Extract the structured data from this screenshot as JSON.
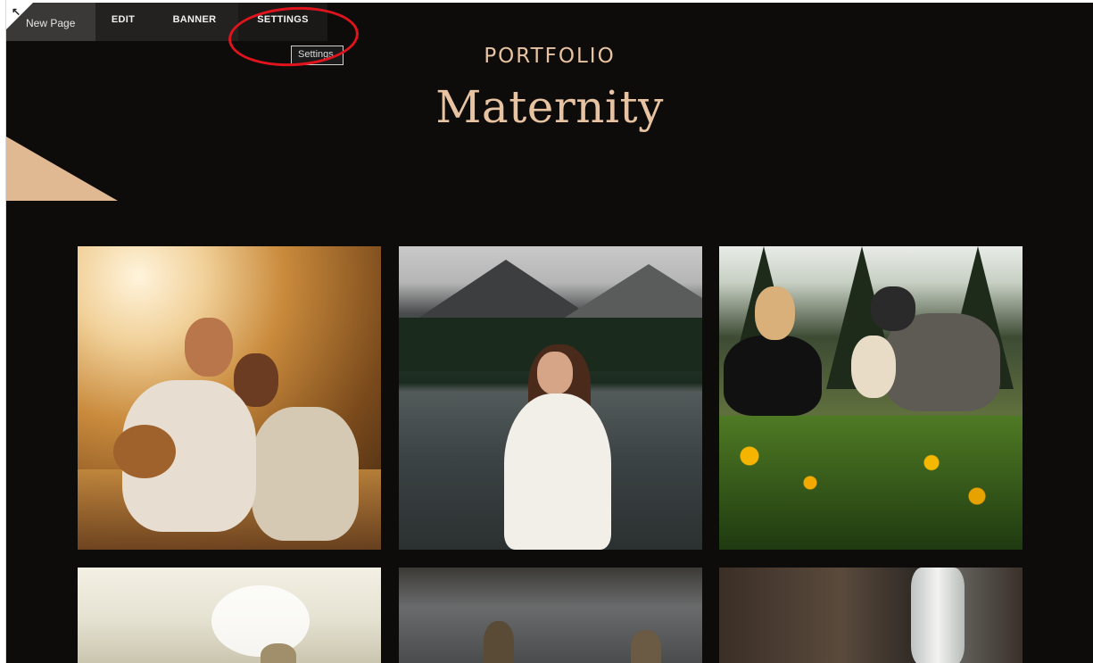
{
  "toolbar": {
    "page_name": "New Page",
    "items": [
      {
        "label": "EDIT"
      },
      {
        "label": "BANNER"
      },
      {
        "label": "SETTINGS"
      }
    ],
    "tooltip": "Settings",
    "corner_icon": "expand-arrow-icon"
  },
  "header": {
    "eyebrow": "PORTFOLIO",
    "title": "Maternity"
  },
  "colors": {
    "page_background": "#0e0c0b",
    "accent": "#e7c3a1",
    "annotation": "#e0141c",
    "toolbar": "#232221"
  },
  "gallery": {
    "photos": [
      {
        "subject": "couple-with-guitar-in-golden-field"
      },
      {
        "subject": "pregnant-woman-in-white-dress-by-mountain-lake"
      },
      {
        "subject": "couple-with-dog-in-wildflower-meadow"
      },
      {
        "subject": "sunlit-field"
      },
      {
        "subject": "reflection-on-water"
      },
      {
        "subject": "waterfall-on-rocks"
      }
    ]
  }
}
